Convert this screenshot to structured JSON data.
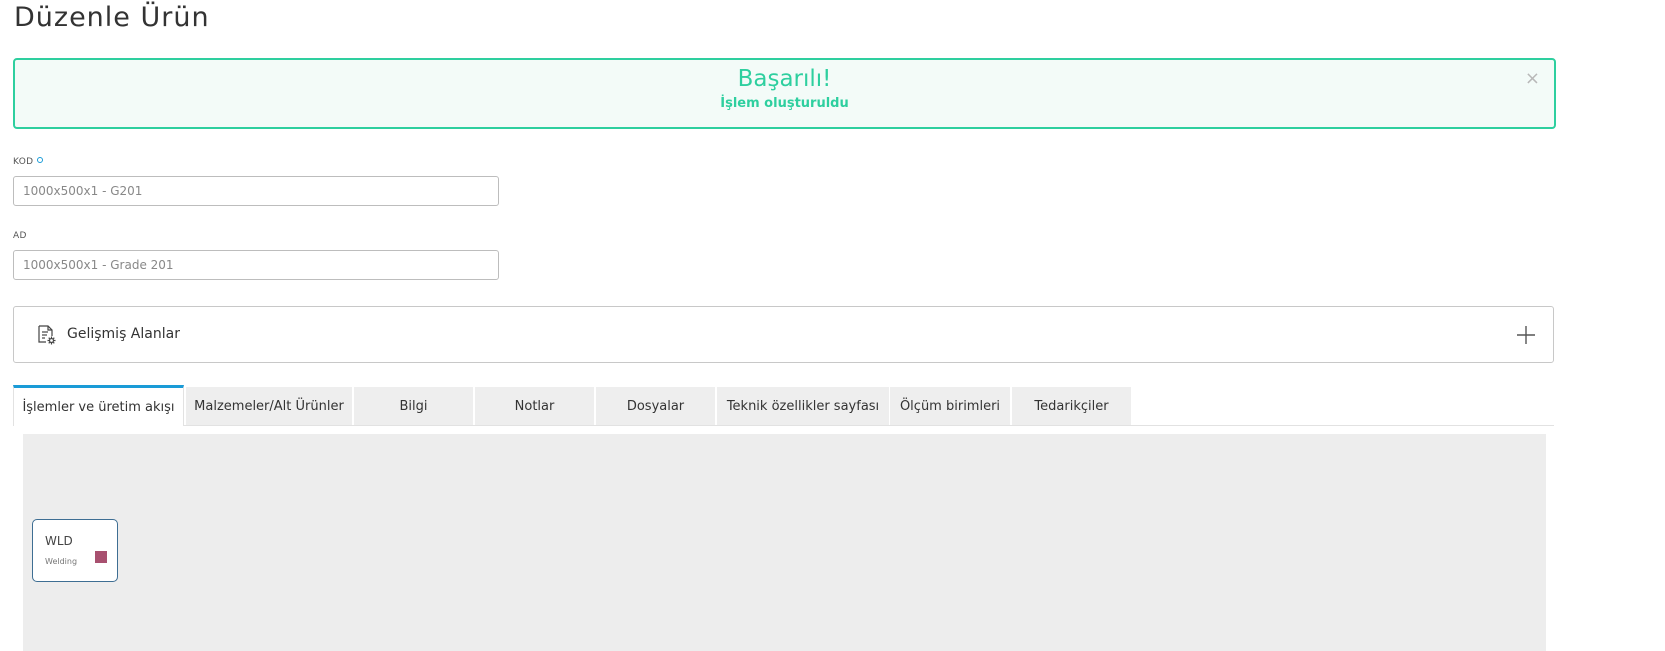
{
  "page": {
    "title": "Düzenle Ürün"
  },
  "alert": {
    "title": "Başarılı!",
    "message": "İşlem oluşturuldu",
    "close_symbol": "×",
    "color": "#2ecf9f"
  },
  "form": {
    "code": {
      "label": "KOD",
      "value": "1000x500x1 - G201",
      "required_indicator_color": "#1a9bd7"
    },
    "name": {
      "label": "AD",
      "value": "1000x500x1 - Grade 201"
    }
  },
  "advanced_fields": {
    "label": "Gelişmiş Alanlar",
    "icon": "document-settings-icon",
    "expand_icon": "plus-icon"
  },
  "tabs": [
    {
      "label": "İşlemler ve üretim akışı",
      "active": true
    },
    {
      "label": "Malzemeler/Alt Ürünler",
      "active": false
    },
    {
      "label": "Bilgi",
      "active": false
    },
    {
      "label": "Notlar",
      "active": false
    },
    {
      "label": "Dosyalar",
      "active": false
    },
    {
      "label": "Teknik özellikler sayfası",
      "active": false
    },
    {
      "label": "Ölçüm birimleri",
      "active": false
    },
    {
      "label": "Tedarikçiler",
      "active": false
    }
  ],
  "workflow": {
    "nodes": [
      {
        "code": "WLD",
        "name": "Welding",
        "color": "#a8506f"
      }
    ]
  },
  "theme": {
    "accent": "#1a9bd7",
    "node_border": "#3e6e93"
  }
}
